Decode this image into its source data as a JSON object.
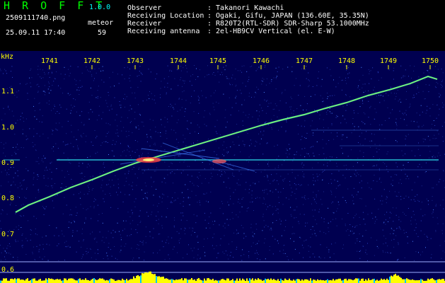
{
  "app": {
    "logo": "H R O F F T",
    "version": "1.0.0"
  },
  "file": {
    "name": "2509111740.png",
    "datetime": "25.09.11 17:40"
  },
  "meteor": {
    "label": "meteor",
    "count": "59"
  },
  "info": [
    {
      "key": "Observer",
      "value": ": Takanori Kawachi"
    },
    {
      "key": "Receiving Location",
      "value": ": Ogaki, Gifu, JAPAN (136.60E, 35.35N)"
    },
    {
      "key": "Receiver",
      "value": ": R820T2(RTL-SDR) SDR-Sharp 53.1000MHz"
    },
    {
      "key": "Receiving antenna",
      "value": ": 2el-HB9CV Vertical (el. E-W)"
    }
  ],
  "spectrogram": {
    "unit": "kHz",
    "time_ticks": [
      "1741",
      "1742",
      "1743",
      "1744",
      "1745",
      "1746",
      "1747",
      "1748",
      "1749",
      "1750"
    ],
    "freq_ticks": [
      "1.1",
      "1.0",
      "0.9",
      "0.8",
      "0.7",
      "0.6"
    ],
    "colors": {
      "background": "#000050",
      "tick": "#ffff00",
      "trace": "#00ffff",
      "hot": "#ff4040",
      "noise_bar": "#ffff00"
    }
  }
}
